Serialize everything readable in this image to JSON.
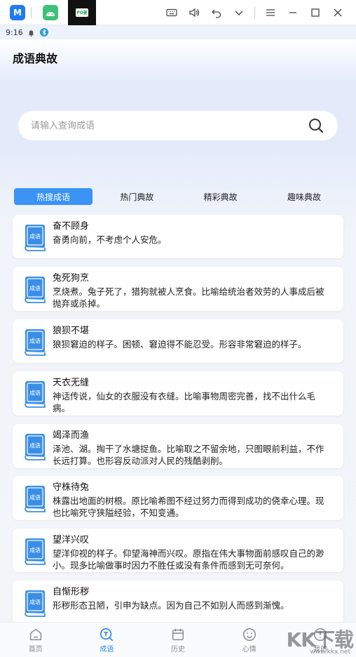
{
  "emulator": {
    "tab_badge": "PO鉴"
  },
  "status_bar": {
    "time": "9:16"
  },
  "app": {
    "title": "成语典故"
  },
  "search": {
    "placeholder": "请输入查询成语"
  },
  "tabs": [
    {
      "label": "热搜成语",
      "active": true
    },
    {
      "label": "热门典故",
      "active": false
    },
    {
      "label": "精彩典故",
      "active": false
    },
    {
      "label": "趣味典故",
      "active": false
    }
  ],
  "book_icon_label": "成语",
  "idioms": [
    {
      "title": "奋不顾身",
      "desc": "奋勇向前，不考虑个人安危。"
    },
    {
      "title": "兔死狗烹",
      "desc": "烹烧煮。兔子死了，猎狗就被人烹食。比喻给统治者效劳的人事成后被抛弃或杀掉。"
    },
    {
      "title": "狼狈不堪",
      "desc": "狼狈窘迫的样子。困顿、窘迫得不能忍受。形容非常窘迫的样子。"
    },
    {
      "title": "天衣无缝",
      "desc": "神话传说，仙女的衣服没有衣缝。比喻事物周密完善，找不出什么毛病。"
    },
    {
      "title": "竭泽而渔",
      "desc": "泽池、湖。掏干了水塘捉鱼。比喻取之不留余地，只图眼前利益，不作长远打算。也形容反动派对人民的残酷剥削。"
    },
    {
      "title": "守株待兔",
      "desc": "株露出地面的树根。原比喻希图不经过努力而得到成功的侥幸心理。现也比喻死守狭隘经验，不知变通。"
    },
    {
      "title": "望洋兴叹",
      "desc": "望洋仰视的样子。仰望海神而兴叹。原指在伟大事物面前感叹自己的渺小。现多比喻做事时因力不胜任或没有条件而感到无可奈何。"
    },
    {
      "title": "自惭形秽",
      "desc": "形秽形态丑陋，引申为缺点。因为自己不如别人而感到渐愧。"
    }
  ],
  "nav": [
    {
      "label": "首页",
      "icon": "home-icon",
      "active": false
    },
    {
      "label": "成语",
      "icon": "idiom-search-icon",
      "active": true
    },
    {
      "label": "历史",
      "icon": "calendar-icon",
      "active": false
    },
    {
      "label": "心情",
      "icon": "smile-icon",
      "active": false
    },
    {
      "label": "我的",
      "icon": "profile-icon",
      "active": false
    }
  ],
  "watermark": {
    "text": "KK下载",
    "url": "www.kkx.net"
  },
  "colors": {
    "accent": "#3b93f5",
    "nav_active": "#2f87f0",
    "book": "#3a8ee8"
  }
}
